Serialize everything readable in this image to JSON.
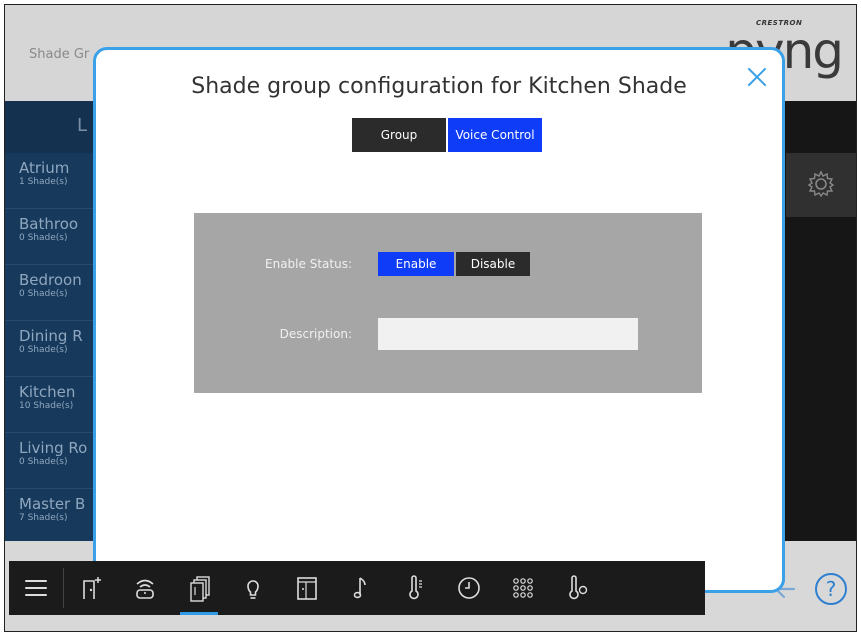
{
  "background": {
    "header_title": "Shade Gr",
    "brand_small": "CRESTRON",
    "brand_big": "pyng",
    "sidebar_heading": "L",
    "sidebar_items": [
      {
        "name": "Atrium",
        "count": "1 Shade(s)"
      },
      {
        "name": "Bathroo",
        "count": "0 Shade(s)"
      },
      {
        "name": "Bedroon",
        "count": "0 Shade(s)"
      },
      {
        "name": "Dining R",
        "count": "0 Shade(s)"
      },
      {
        "name": "Kitchen",
        "count": "10 Shade(s)"
      },
      {
        "name": "Living Ro",
        "count": "0 Shade(s)"
      },
      {
        "name": "Master B",
        "count": "7 Shade(s)"
      }
    ]
  },
  "modal": {
    "title": "Shade group configuration for Kitchen Shade",
    "tabs": [
      {
        "label": "Group",
        "active": false
      },
      {
        "label": "Voice Control",
        "active": true
      }
    ],
    "enable_status_label": "Enable Status:",
    "enable_label": "Enable",
    "disable_label": "Disable",
    "enabled": true,
    "description_label": "Description:",
    "description_value": ""
  },
  "toolbar": {
    "items": [
      {
        "icon": "menu-icon"
      },
      {
        "icon": "add-room-icon"
      },
      {
        "icon": "pyng-hub-icon"
      },
      {
        "icon": "shades-icon",
        "active": true
      },
      {
        "icon": "lightbulb-icon"
      },
      {
        "icon": "door-window-icon"
      },
      {
        "icon": "music-note-icon"
      },
      {
        "icon": "thermometer-icon"
      },
      {
        "icon": "clock-icon"
      },
      {
        "icon": "keypad-icon"
      },
      {
        "icon": "thermostat-sensor-icon"
      }
    ]
  },
  "colors": {
    "accent": "#0f3cf6",
    "modal_border": "#3aa0e8",
    "sidebar": "#173a5c",
    "toolbar": "#1b1b1b"
  }
}
